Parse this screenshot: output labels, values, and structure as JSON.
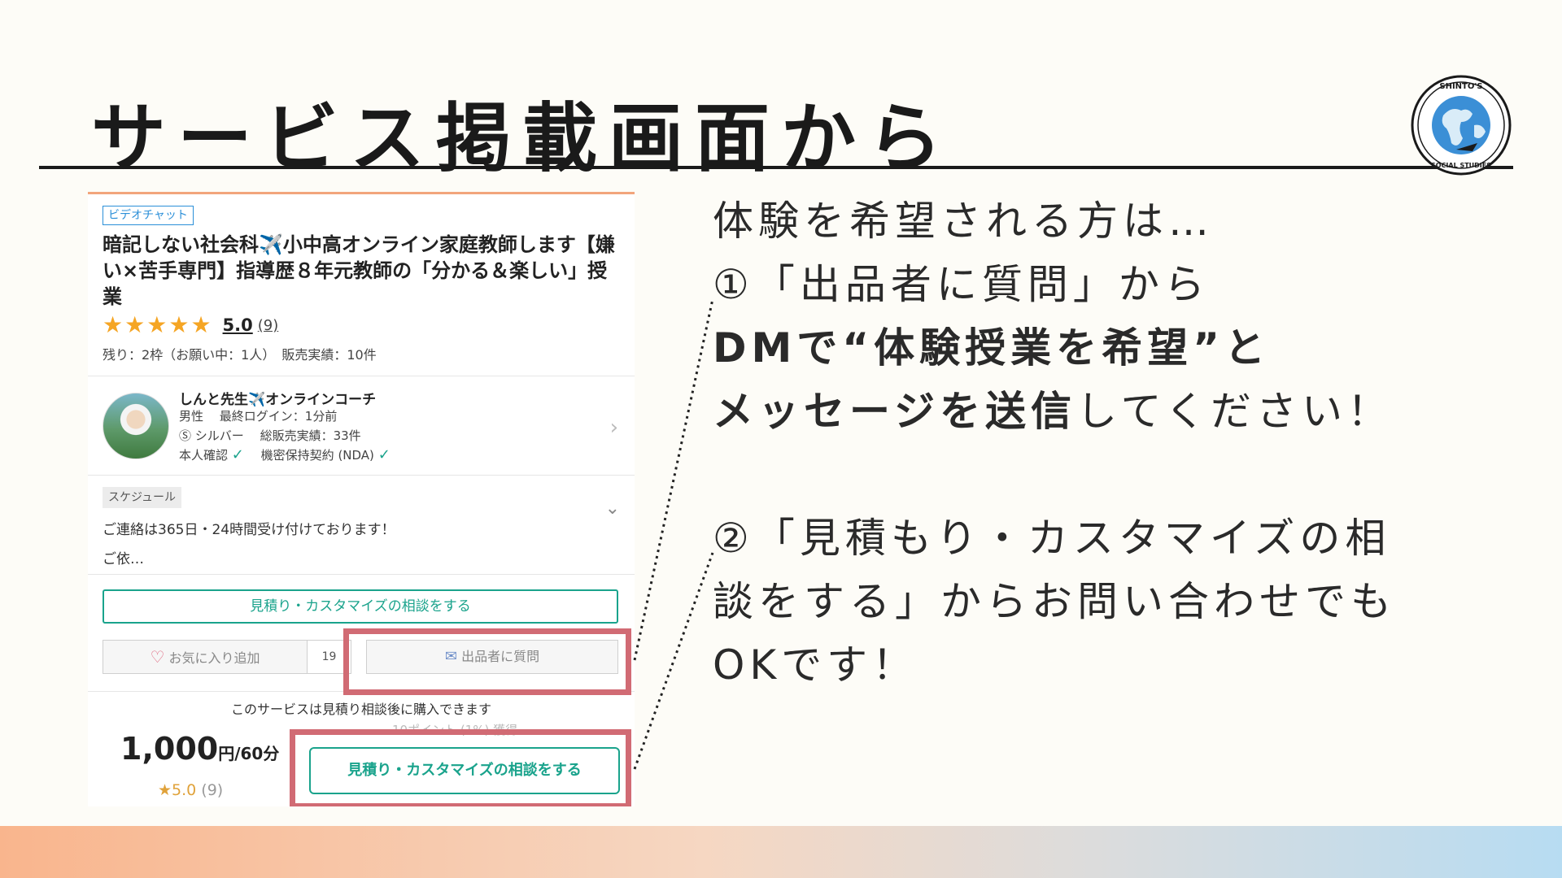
{
  "slide": {
    "title": "サービス掲載画面から",
    "logo_top_text": "SHINTO'S",
    "logo_bottom_text": "SOCIAL STUDIES"
  },
  "service": {
    "tag": "ビデオチャット",
    "title": "暗記しない社会科✈️小中高オンライン家庭教師します【嫌い×苦手専門】指導歴８年元教師の「分かる＆楽しい」授業",
    "stars": [
      "★",
      "★",
      "★",
      "★",
      "★"
    ],
    "rating": "5.0",
    "rating_count": "(9)",
    "stock": "残り：2枠（お願い中：1人）　販売実績：10件"
  },
  "seller": {
    "name": "しんと先生✈️オンラインコーチ",
    "line1": "男性　 最終ログイン：1分前",
    "rank_icon": "Ⓢ",
    "line2": "シルバー　 総販売実績：33件",
    "verify1": "本人確認",
    "verify2": "機密保持契約 (NDA)",
    "check": "✓",
    "chevron": "›"
  },
  "schedule": {
    "label": "スケジュール",
    "text1": "ご連絡は365日・24時間受け付けております！",
    "text2": "ご依…",
    "chevron": "⌄"
  },
  "actions": {
    "quote_button": "見積り・カスタマイズの相談をする",
    "heart": "♡",
    "favorite": "お気に入り追加",
    "favorite_count": "19",
    "mail_icon": "✉",
    "ask_seller": "出品者に質問"
  },
  "purchase": {
    "note": "このサービスは見積り相談後に購入できます",
    "price": "1,000",
    "price_unit": "円/60分",
    "rating": "★5.0",
    "rating_count": " (9)",
    "points": "10ポイント (1%) 獲得",
    "quote_button": "見積り・カスタマイズの相談をする"
  },
  "explanation": {
    "line1": "体験を希望される方は…",
    "line2": "①「出品者に質問」から",
    "line3": "DMで“体験授業を希望”と",
    "line4_bold": "メッセージを送信",
    "line4_rest": "してください！",
    "line5": "②「見積もり・カスタマイズの相",
    "line6": "談をする」からお問い合わせでも",
    "line7": "OKです！"
  },
  "colors": {
    "accent_green": "#1aa38c",
    "highlight_red": "#d16b74",
    "star": "#f5a524",
    "tag_blue": "#2b8fd8"
  }
}
